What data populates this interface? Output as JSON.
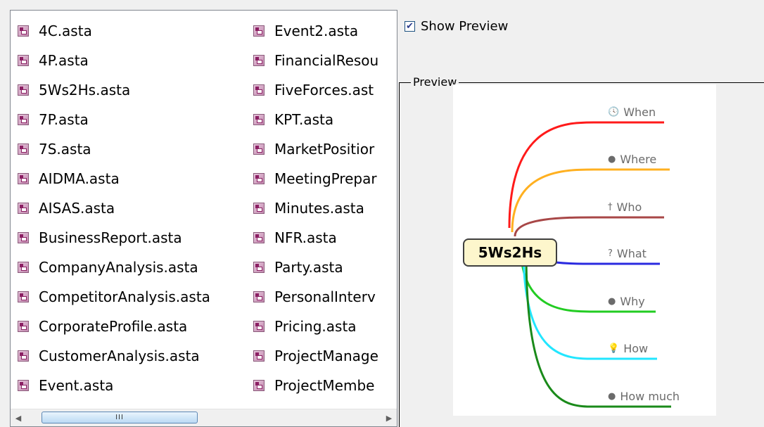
{
  "file_list": {
    "column1": [
      "4C.asta",
      "4P.asta",
      "5Ws2Hs.asta",
      "7P.asta",
      "7S.asta",
      "AIDMA.asta",
      "AISAS.asta",
      "BusinessReport.asta",
      "CompanyAnalysis.asta",
      "CompetitorAnalysis.asta",
      "CorporateProfile.asta",
      "CustomerAnalysis.asta",
      "Event.asta"
    ],
    "column2": [
      "Event2.asta",
      "FinancialResou",
      "FiveForces.ast",
      "KPT.asta",
      "MarketPositior",
      "MeetingPrepar",
      "Minutes.asta",
      "NFR.asta",
      "Party.asta",
      "PersonalInterv",
      "Pricing.asta",
      "ProjectManage",
      "ProjectMembe"
    ],
    "scrollbar_grip": "III"
  },
  "show_preview": {
    "label": "Show Preview",
    "checked": true
  },
  "preview": {
    "legend": "Preview",
    "mindmap": {
      "center": "5Ws2Hs",
      "branches": [
        {
          "label": "When",
          "icon": "clock-icon",
          "glyph": "🕓",
          "color": "#ff1a1a"
        },
        {
          "label": "Where",
          "icon": "globe-icon",
          "glyph": "●",
          "color": "#ffb020"
        },
        {
          "label": "Who",
          "icon": "person-icon",
          "glyph": "†",
          "color": "#a84747"
        },
        {
          "label": "What",
          "icon": "question-icon",
          "glyph": "?",
          "color": "#2a2ae0"
        },
        {
          "label": "Why",
          "icon": "confused-face-icon",
          "glyph": "●",
          "color": "#22cc22"
        },
        {
          "label": "How",
          "icon": "lightbulb-icon",
          "glyph": "💡",
          "color": "#22e6ff"
        },
        {
          "label": "How much",
          "icon": "coins-icon",
          "glyph": "●",
          "color": "#1a8a1a"
        }
      ]
    }
  }
}
